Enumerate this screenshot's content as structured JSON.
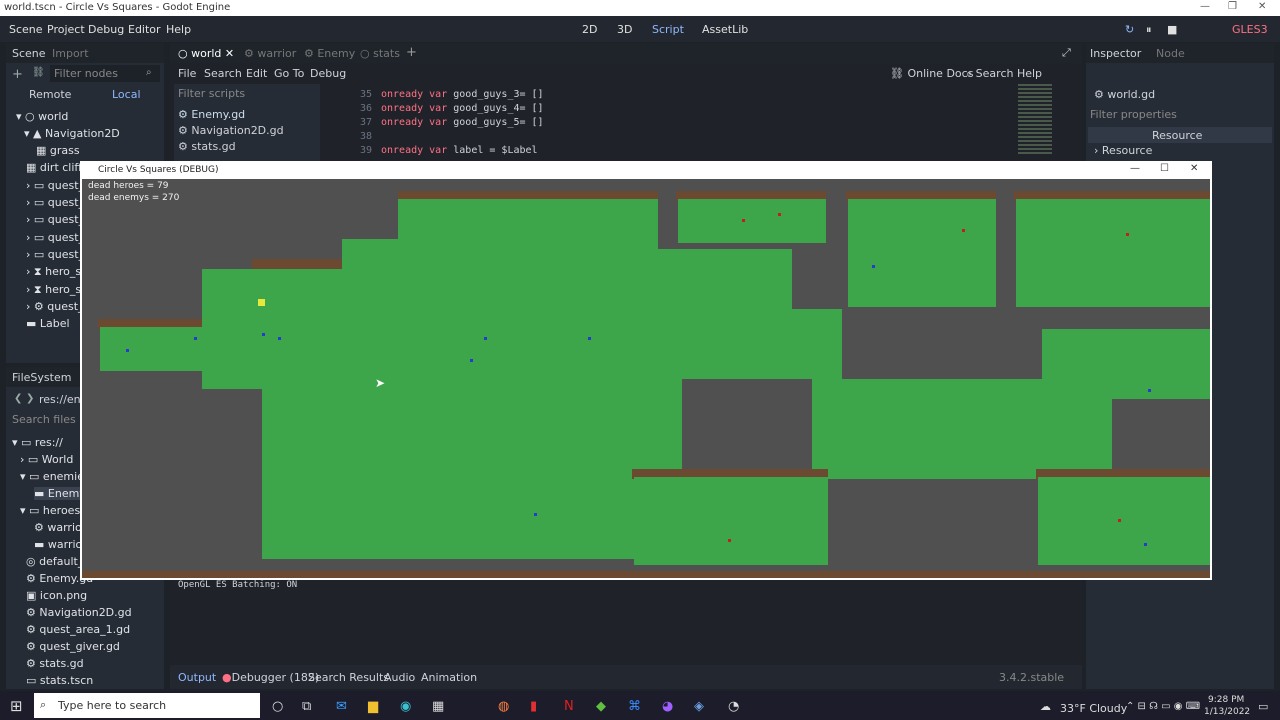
{
  "window": {
    "title": "world.tscn - Circle Vs Squares - Godot Engine"
  },
  "menu": [
    "Scene",
    "Project",
    "Debug",
    "Editor",
    "Help"
  ],
  "workspaces": [
    "2D",
    "3D",
    "Script",
    "AssetLib"
  ],
  "renderer": "GLES3",
  "scene_dock": {
    "tabs": [
      "Scene",
      "Import"
    ],
    "filter_placeholder": "Filter nodes",
    "remote": "Remote",
    "local": "Local",
    "nodes": [
      "world",
      "Navigation2D",
      "grass",
      "dirt cliff",
      "quest_ar",
      "quest_ar",
      "quest_ar",
      "quest_ar",
      "quest_ar",
      "hero_spa",
      "hero_spa",
      "quest_gi",
      "Label"
    ]
  },
  "filesystem": {
    "title": "FileSystem",
    "path": "res://ene",
    "search_placeholder": "Search files",
    "items": [
      "res://",
      "World",
      "enemies",
      "Enemy",
      "heroes",
      "warrio",
      "warrio",
      "default_e",
      "Enemy.gd",
      "icon.png",
      "Navigation2D.gd",
      "quest_area_1.gd",
      "quest_giver.gd",
      "stats.gd",
      "stats.tscn"
    ]
  },
  "editor_tabs": [
    "world",
    "warrior",
    "Enemy",
    "stats"
  ],
  "script_menu": [
    "File",
    "Search",
    "Edit",
    "Go To",
    "Debug"
  ],
  "online_docs": "Online Docs",
  "search_help": "Search Help",
  "scripts_filter": "Filter scripts",
  "scripts": [
    "Enemy.gd",
    "Navigation2D.gd",
    "stats.gd"
  ],
  "code": [
    {
      "n": "35",
      "kw": "onready var",
      "rest": " good_guys_3= []"
    },
    {
      "n": "36",
      "kw": "onready var",
      "rest": " good_guys_4= []"
    },
    {
      "n": "37",
      "kw": "onready var",
      "rest": " good_guys_5= []"
    },
    {
      "n": "38",
      "kw": "",
      "rest": ""
    },
    {
      "n": "39",
      "kw": "onready var",
      "rest": " label = $Label"
    }
  ],
  "inspector": {
    "tabs": [
      "Inspector",
      "Node"
    ],
    "object": "world.gd",
    "filter": "Filter properties",
    "resource_hdr": "Resource",
    "resource_row": "Resource"
  },
  "game_window": {
    "title": "Circle Vs Squares (DEBUG)",
    "dead_heroes": "dead heroes = 79",
    "dead_enemys": "dead enemys = 270"
  },
  "output": {
    "log": "OpenGL ES Batching: ON",
    "tabs": [
      "Output",
      "Debugger (182)",
      "Search Results",
      "Audio",
      "Animation"
    ],
    "version": "3.4.2.stable"
  },
  "taskbar": {
    "search": "Type here to search",
    "weather": "33°F  Cloudy",
    "time": "9:28 PM",
    "date": "1/13/2022"
  }
}
